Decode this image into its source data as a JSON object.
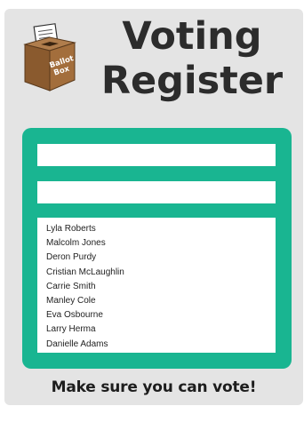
{
  "title": {
    "line1": "Voting",
    "line2": "Register"
  },
  "logo": {
    "icon": "ballot-box-icon",
    "line1": "Ballot",
    "line2": "Box"
  },
  "form": {
    "field1": {
      "value": "",
      "placeholder": ""
    },
    "field2": {
      "value": "",
      "placeholder": ""
    },
    "names": [
      "Lyla Roberts",
      "Malcolm Jones",
      "Deron Purdy",
      "Cristian McLaughlin",
      "Carrie Smith",
      "Manley Cole",
      "Eva Osbourne",
      "Larry Herma",
      "Danielle Adams"
    ]
  },
  "footer": {
    "text": "Make sure you can vote!"
  },
  "colors": {
    "background": "#e4e4e4",
    "panel": "#19b591",
    "box": "#9c6b3d",
    "box_dark": "#6e4622",
    "text": "#2c2c2c"
  }
}
